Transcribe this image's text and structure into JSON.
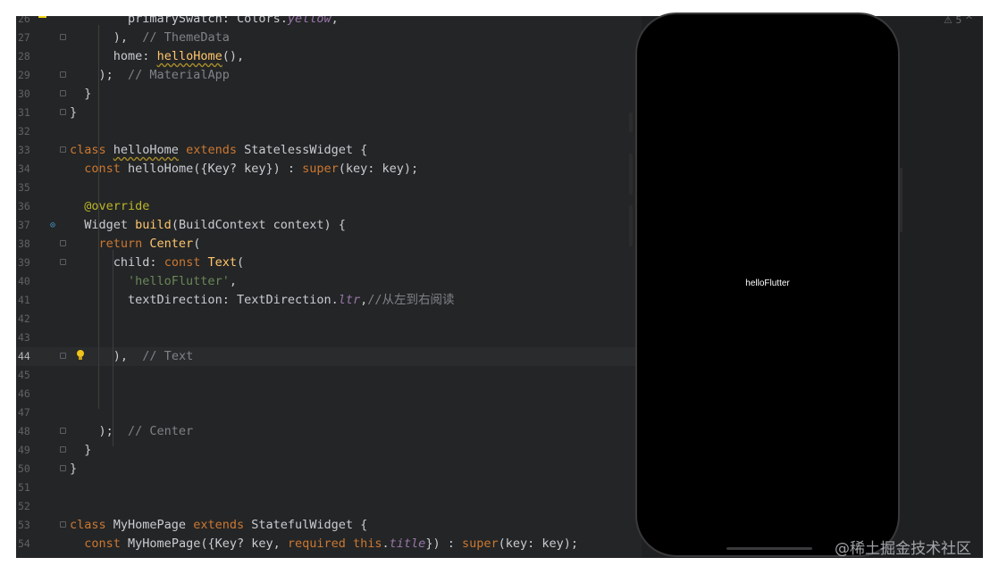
{
  "editor": {
    "lines": [
      {
        "n": "26",
        "html": "primarySwatch",
        "parts": [
          [
            "        ",
            ""
          ],
          [
            "primarySwatch: Colors.",
            ""
          ],
          [
            "yellow",
            "prop"
          ],
          [
            ",",
            ""
          ]
        ]
      },
      {
        "n": "27",
        "parts": [
          [
            "      ",
            ""
          ],
          [
            "),",
            ""
          ],
          [
            "  // ThemeData",
            "cm"
          ]
        ]
      },
      {
        "n": "28",
        "parts": [
          [
            "      ",
            ""
          ],
          [
            "home: ",
            ""
          ],
          [
            "helloHome",
            "fn squig"
          ],
          [
            "(),",
            ""
          ]
        ]
      },
      {
        "n": "29",
        "parts": [
          [
            "    ",
            ""
          ],
          [
            ");",
            ""
          ],
          [
            "  // MaterialApp",
            "cm"
          ]
        ]
      },
      {
        "n": "30",
        "parts": [
          [
            "  ",
            ""
          ],
          [
            "}",
            ""
          ]
        ]
      },
      {
        "n": "31",
        "parts": [
          [
            "}",
            ""
          ]
        ]
      },
      {
        "n": "32",
        "parts": []
      },
      {
        "n": "33",
        "parts": [
          [
            "class ",
            "kw"
          ],
          [
            "helloHome",
            "cls squig"
          ],
          [
            " extends ",
            "kw"
          ],
          [
            "StatelessWidget {",
            ""
          ]
        ]
      },
      {
        "n": "34",
        "parts": [
          [
            "  ",
            ""
          ],
          [
            "const ",
            "kw"
          ],
          [
            "helloHome({Key? key}) : ",
            ""
          ],
          [
            "super",
            "kw"
          ],
          [
            "(key: key);",
            ""
          ]
        ]
      },
      {
        "n": "35",
        "parts": []
      },
      {
        "n": "36",
        "parts": [
          [
            "  ",
            ""
          ],
          [
            "@override",
            "anno"
          ]
        ]
      },
      {
        "n": "37",
        "parts": [
          [
            "  ",
            ""
          ],
          [
            "Widget ",
            ""
          ],
          [
            "build",
            "fn"
          ],
          [
            "(BuildContext context) {",
            ""
          ]
        ]
      },
      {
        "n": "38",
        "parts": [
          [
            "    ",
            ""
          ],
          [
            "return ",
            "kw"
          ],
          [
            "Center",
            "fn"
          ],
          [
            "(",
            ""
          ]
        ]
      },
      {
        "n": "39",
        "parts": [
          [
            "      ",
            ""
          ],
          [
            "child: ",
            ""
          ],
          [
            "const ",
            "kw"
          ],
          [
            "Text",
            "fn"
          ],
          [
            "(",
            ""
          ]
        ]
      },
      {
        "n": "40",
        "parts": [
          [
            "        ",
            ""
          ],
          [
            "'helloFlutter'",
            "str"
          ],
          [
            ",",
            ""
          ]
        ]
      },
      {
        "n": "41",
        "parts": [
          [
            "        ",
            ""
          ],
          [
            "textDirection: TextDirection.",
            ""
          ],
          [
            "ltr",
            "prop"
          ],
          [
            ",",
            ""
          ],
          [
            "//从左到右阅读",
            "cm"
          ]
        ]
      },
      {
        "n": "42",
        "parts": []
      },
      {
        "n": "43",
        "parts": []
      },
      {
        "n": "44",
        "parts": [
          [
            "      ",
            ""
          ],
          [
            "),",
            ""
          ],
          [
            "  // Text",
            "cm"
          ]
        ]
      },
      {
        "n": "45",
        "parts": []
      },
      {
        "n": "46",
        "parts": []
      },
      {
        "n": "47",
        "parts": []
      },
      {
        "n": "48",
        "parts": [
          [
            "    ",
            ""
          ],
          [
            ");",
            ""
          ],
          [
            "  // Center",
            "cm"
          ]
        ]
      },
      {
        "n": "49",
        "parts": [
          [
            "  ",
            ""
          ],
          [
            "}",
            ""
          ]
        ]
      },
      {
        "n": "50",
        "parts": [
          [
            "}",
            ""
          ]
        ]
      },
      {
        "n": "51",
        "parts": []
      },
      {
        "n": "52",
        "parts": []
      },
      {
        "n": "53",
        "parts": [
          [
            "class ",
            "kw"
          ],
          [
            "MyHomePage ",
            ""
          ],
          [
            "extends ",
            "kw"
          ],
          [
            "StatefulWidget {",
            ""
          ]
        ]
      },
      {
        "n": "54",
        "parts": [
          [
            "  ",
            ""
          ],
          [
            "const ",
            "kw"
          ],
          [
            "MyHomePage({Key? key, ",
            ""
          ],
          [
            "required this",
            "kw"
          ],
          [
            ".",
            ""
          ],
          [
            "title",
            "prop"
          ],
          [
            "}) : ",
            ""
          ],
          [
            "super",
            "kw"
          ],
          [
            "(key: key);",
            ""
          ]
        ]
      }
    ],
    "current_line": "44"
  },
  "preview": {
    "app_text": "helloFlutter"
  },
  "watermark": "@稀土掘金技术社区",
  "colors": {
    "background": "#242526",
    "accent_yellow": "#f1d21a"
  }
}
